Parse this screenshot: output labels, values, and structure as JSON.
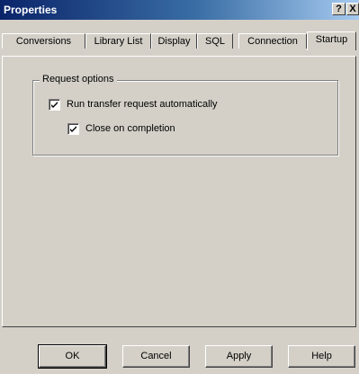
{
  "window": {
    "title": "Properties",
    "help_glyph": "?",
    "close_glyph": "X"
  },
  "tabs": [
    {
      "label": "Conversions",
      "active": false
    },
    {
      "label": "Library List",
      "active": false
    },
    {
      "label": "Display",
      "active": false
    },
    {
      "label": "SQL",
      "active": false
    },
    {
      "label": "Connection",
      "active": false
    },
    {
      "label": "Startup",
      "active": true
    }
  ],
  "request_options": {
    "group_label": "Request options",
    "run_transfer": {
      "label": "Run transfer request automatically",
      "checked": true
    },
    "close_on_completion": {
      "label": "Close on completion",
      "checked": true
    }
  },
  "buttons": {
    "ok": "OK",
    "cancel": "Cancel",
    "apply": "Apply",
    "help": "Help"
  },
  "colors": {
    "titlebar_start": "#0a246a",
    "titlebar_end": "#a6caf0",
    "face": "#d4d0c8"
  }
}
